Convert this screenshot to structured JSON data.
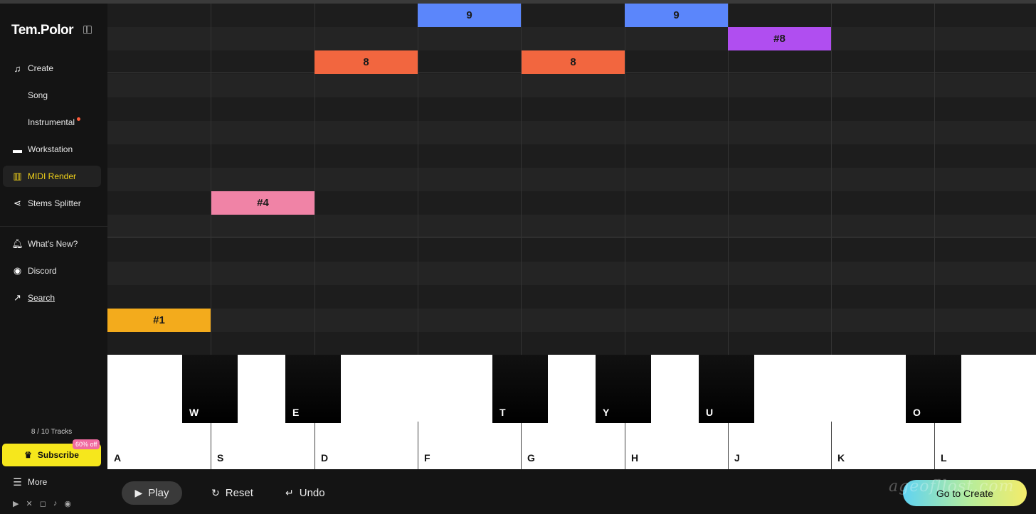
{
  "sidebar": {
    "logo": "Tem.Polor",
    "items": [
      {
        "label": "Create",
        "icon": "music-note-icon"
      },
      {
        "label": "Song"
      },
      {
        "label": "Instrumental"
      },
      {
        "label": "Workstation",
        "icon": "workstation-icon"
      },
      {
        "label": "MIDI Render",
        "icon": "piano-icon"
      },
      {
        "label": "Stems Splitter",
        "icon": "split-icon"
      },
      {
        "label": "What's New?",
        "icon": "bell-icon"
      },
      {
        "label": "Discord",
        "icon": "discord-icon"
      },
      {
        "label": "Search",
        "icon": "arrow-up-right-icon"
      }
    ],
    "tracks": "8 / 10 Tracks",
    "subscribe": "Subscribe",
    "discount": "60% off",
    "more": "More"
  },
  "grid": {
    "notes": [
      {
        "label": "9",
        "color": "#5b86fb"
      },
      {
        "label": "9",
        "color": "#5b86fb"
      },
      {
        "label": "#8",
        "color": "#b04ef0"
      },
      {
        "label": "8",
        "color": "#f2663f"
      },
      {
        "label": "8",
        "color": "#f2663f"
      },
      {
        "label": "#4",
        "color": "#f083a6"
      },
      {
        "label": "#1",
        "color": "#f3ab1c"
      }
    ]
  },
  "keyboard": {
    "white_keys": [
      "A",
      "S",
      "D",
      "F",
      "G",
      "H",
      "J",
      "K",
      "L"
    ],
    "black_keys": [
      "W",
      "E",
      "T",
      "Y",
      "U",
      "O"
    ]
  },
  "controls": {
    "play": "Play",
    "reset": "Reset",
    "undo": "Undo",
    "go_to_create": "Go to Create",
    "watermark": "ageofllost.com"
  }
}
